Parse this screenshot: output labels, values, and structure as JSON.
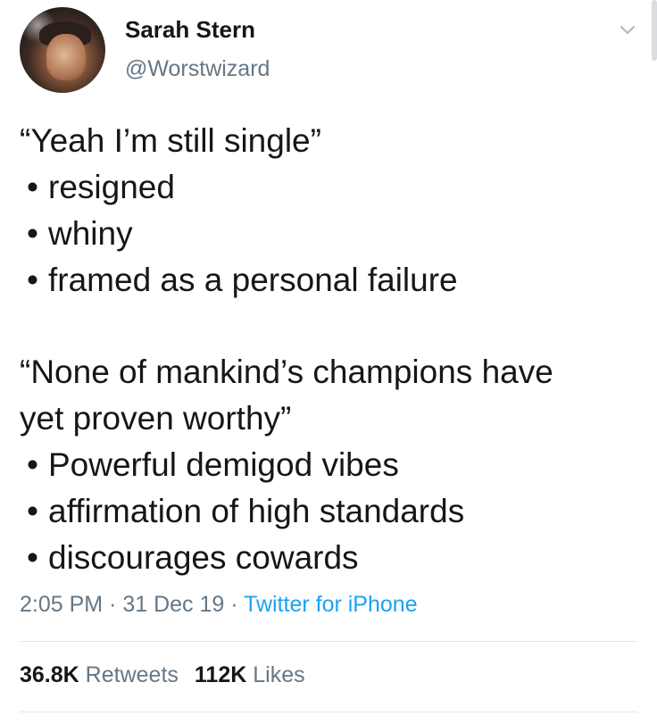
{
  "author": {
    "display_name": "Sarah Stern",
    "handle": "@Worstwizard",
    "avatar_icon": "profile-photo"
  },
  "menu": {
    "icon": "chevron-down-icon"
  },
  "tweet": {
    "block1": {
      "quote": "“Yeah I’m still single”",
      "bullets": [
        "resigned",
        "whiny",
        "framed as a personal failure"
      ]
    },
    "block2": {
      "quote_line1": "“None of mankind’s champions have",
      "quote_line2": "yet proven worthy”",
      "bullets": [
        "Powerful demigod vibes",
        "affirmation of high standards",
        "discourages cowards"
      ]
    },
    "bullet_char": "•"
  },
  "meta": {
    "time": "2:05 PM",
    "date": "31 Dec 19",
    "separator": " · ",
    "source": "Twitter for iPhone"
  },
  "stats": {
    "retweets_count": "36.8K",
    "retweets_label": "Retweets",
    "likes_count": "112K",
    "likes_label": "Likes"
  },
  "colors": {
    "text": "#14171a",
    "secondary": "#657786",
    "link": "#1da1f2",
    "divider": "#e1e8ed"
  }
}
